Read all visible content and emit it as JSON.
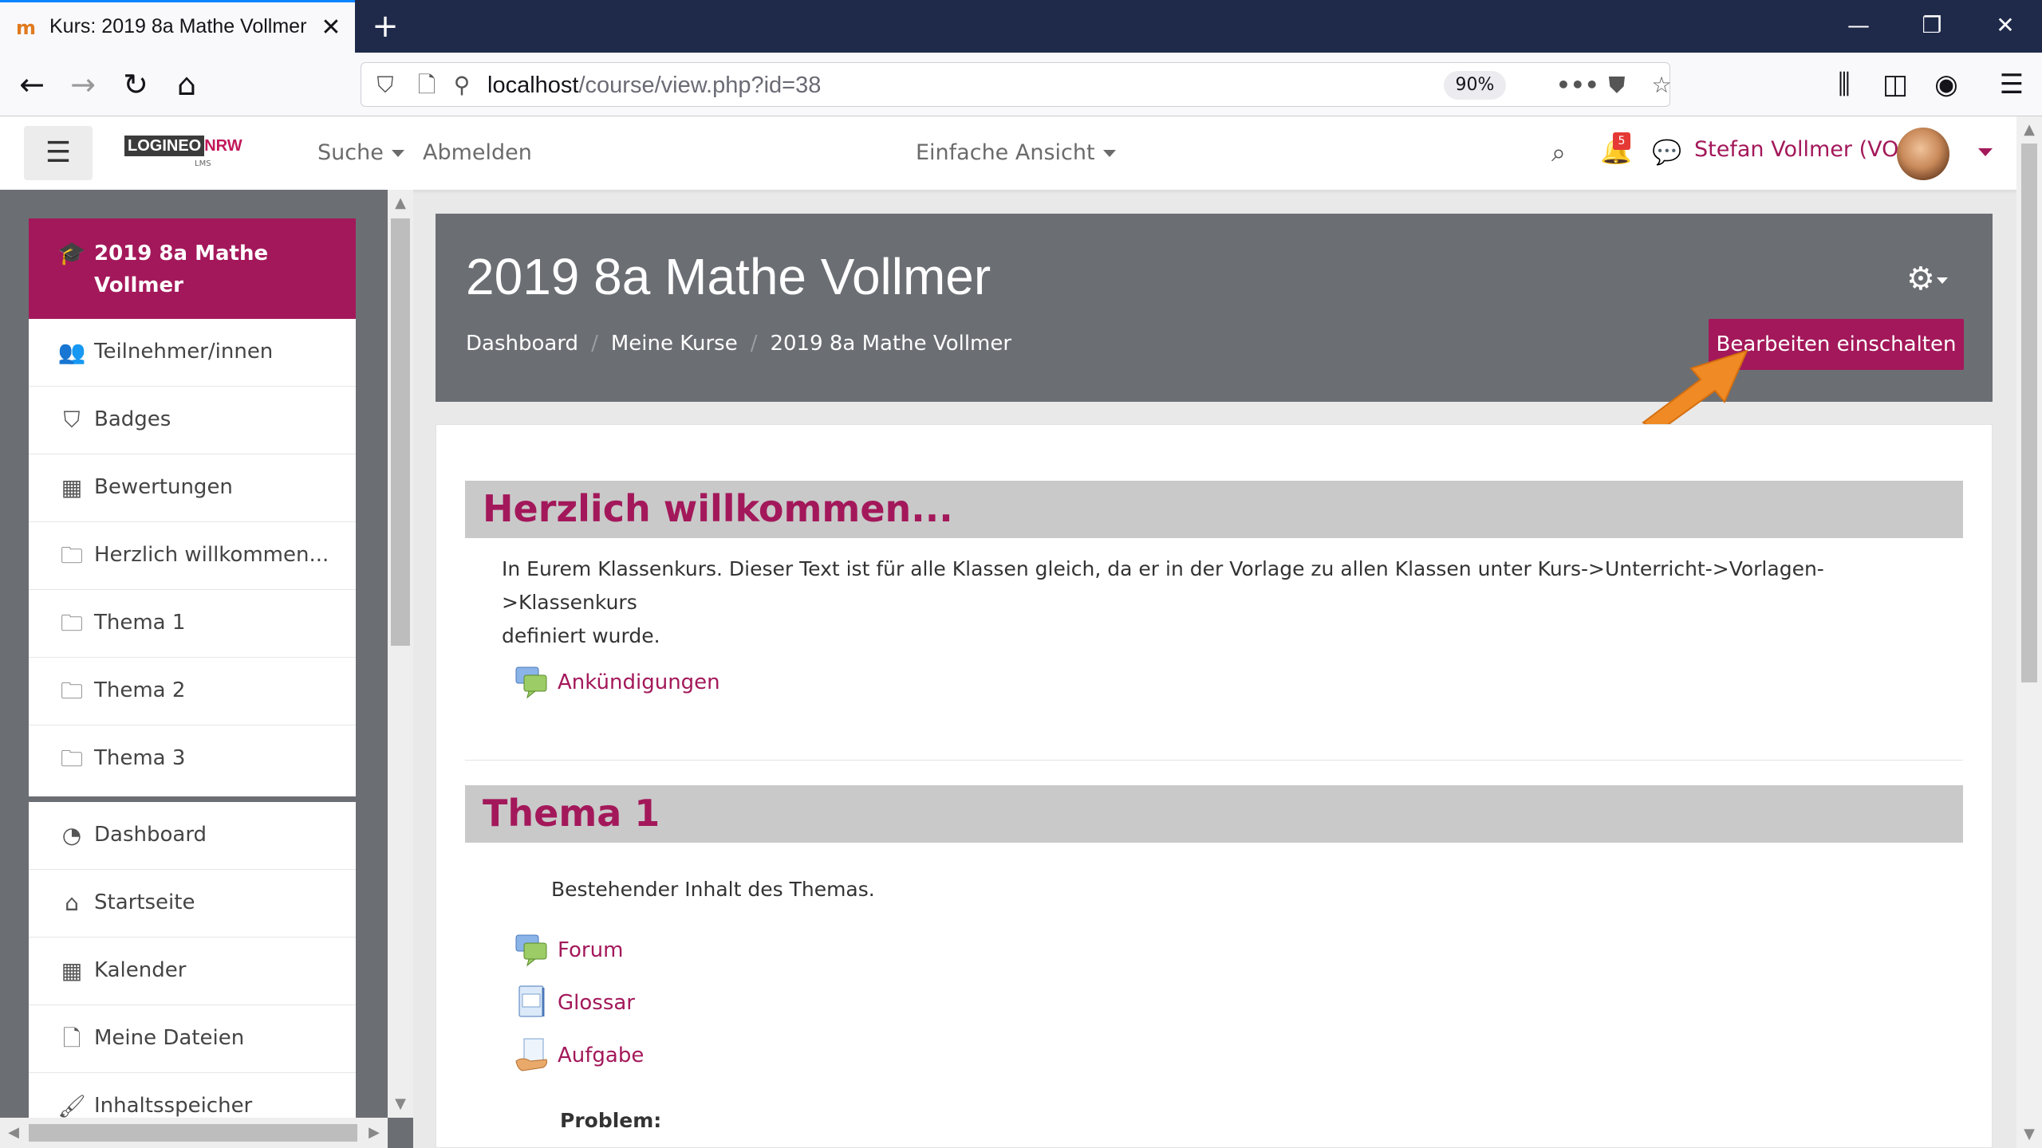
{
  "browser": {
    "tab_title": "Kurs: 2019 8a Mathe Vollmer",
    "url_host": "localhost",
    "url_path": "/course/view.php?id=38",
    "zoom": "90%"
  },
  "moodle_nav": {
    "search_label": "Suche",
    "logout_label": "Abmelden",
    "view_label": "Einfache Ansicht",
    "notification_count": "5",
    "user_name": "Stefan Vollmer (VOL)"
  },
  "drawer": {
    "course_items": [
      {
        "label": "2019 8a Mathe Vollmer",
        "icon": "graduation-cap-icon"
      },
      {
        "label": "Teilnehmer/innen",
        "icon": "users-icon"
      },
      {
        "label": "Badges",
        "icon": "shield-icon"
      },
      {
        "label": "Bewertungen",
        "icon": "table-icon"
      },
      {
        "label": "Herzlich willkommen...",
        "icon": "folder-icon"
      },
      {
        "label": "Thema 1",
        "icon": "folder-icon"
      },
      {
        "label": "Thema 2",
        "icon": "folder-icon"
      },
      {
        "label": "Thema 3",
        "icon": "folder-icon"
      }
    ],
    "site_items": [
      {
        "label": "Dashboard",
        "icon": "dashboard-icon"
      },
      {
        "label": "Startseite",
        "icon": "home-icon"
      },
      {
        "label": "Kalender",
        "icon": "calendar-icon"
      },
      {
        "label": "Meine Dateien",
        "icon": "file-icon"
      },
      {
        "label": "Inhaltsspeicher",
        "icon": "brush-icon"
      }
    ]
  },
  "header": {
    "title": "2019 8a Mathe Vollmer",
    "breadcrumbs": [
      "Dashboard",
      "Meine Kurse",
      "2019 8a Mathe Vollmer"
    ],
    "edit_button": "Bearbeiten einschalten"
  },
  "sections": [
    {
      "title": "Herzlich willkommen...",
      "summary_line1": "In Eurem Klassenkurs. Dieser Text ist für alle Klassen gleich, da er in der Vorlage zu allen Klassen unter Kurs->Unterricht->Vorlagen->Klassenkurs",
      "summary_line2": "definiert wurde.",
      "activities": [
        {
          "label": "Ankündigungen",
          "icon": "forum-icon"
        }
      ]
    },
    {
      "title": "Thema 1",
      "summary": "Bestehender Inhalt des Themas.",
      "activities": [
        {
          "label": "Forum",
          "icon": "forum-icon"
        },
        {
          "label": "Glossar",
          "icon": "glossary-icon"
        },
        {
          "label": "Aufgabe",
          "icon": "assignment-icon"
        }
      ],
      "trailing_text": "Problem:"
    }
  ],
  "colors": {
    "brand": "#a3185a",
    "header_bg": "#6b6e73",
    "section_bg": "#c9c9c9",
    "annotation_arrow": "#f08a24"
  }
}
